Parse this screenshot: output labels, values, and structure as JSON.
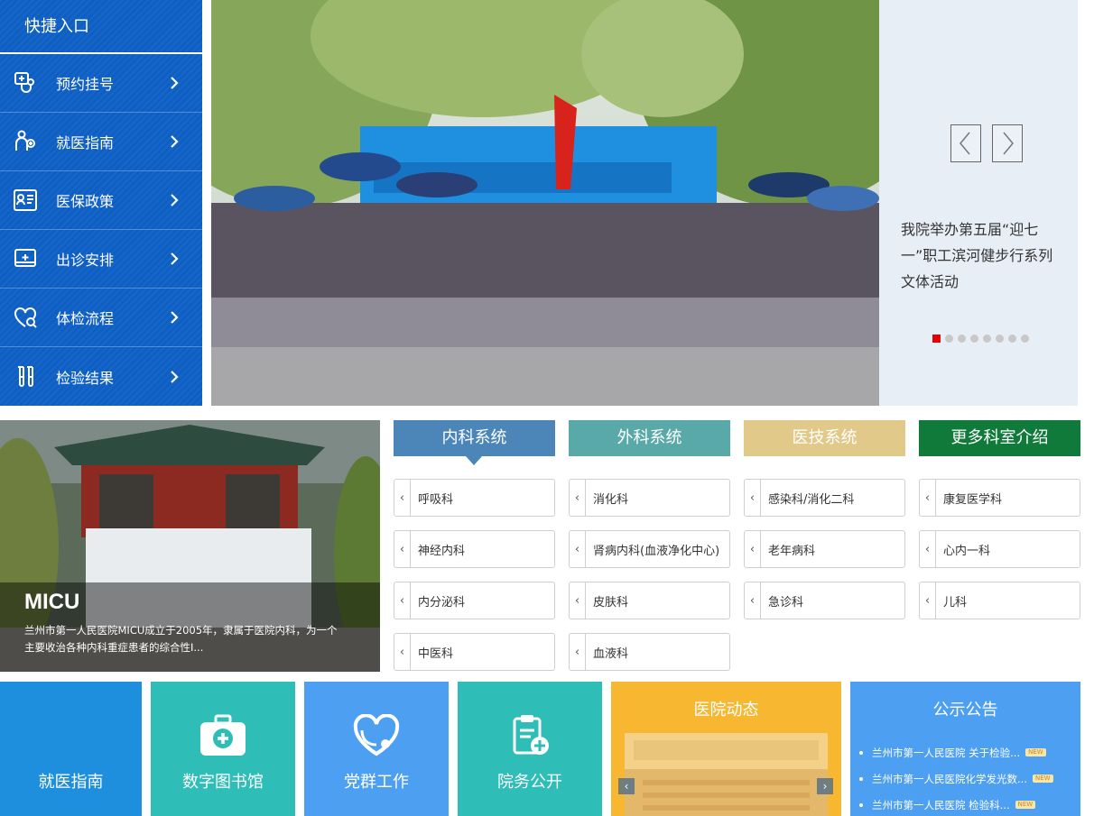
{
  "quick_entry": {
    "title": "快捷入口",
    "items": [
      {
        "label": "预约挂号",
        "icon": "stethoscope-icon"
      },
      {
        "label": "就医指南",
        "icon": "doctor-guide-icon"
      },
      {
        "label": "医保政策",
        "icon": "insurance-card-icon"
      },
      {
        "label": "出诊安排",
        "icon": "schedule-icon"
      },
      {
        "label": "体检流程",
        "icon": "heart-check-icon"
      },
      {
        "label": "检验结果",
        "icon": "test-tubes-icon"
      }
    ]
  },
  "banner": {
    "caption": "我院举办第五届“迎七一”职工滨河健步行系列文体活动",
    "slide_count": 8,
    "active_slide": 1
  },
  "dept_feature": {
    "title": "MICU",
    "description": "兰州市第一人民医院MICU成立于2005年，隶属于医院内科，为一个主要收治各种内科重症患者的综合性I..."
  },
  "dept_tabs": [
    {
      "label": "内科系统"
    },
    {
      "label": "外科系统"
    },
    {
      "label": "医技系统"
    },
    {
      "label": "更多科室介绍"
    }
  ],
  "departments": [
    [
      "呼吸科",
      "神经内科",
      "内分泌科",
      "中医科"
    ],
    [
      "消化科",
      "肾病内科(血液净化中心)",
      "皮肤科",
      "血液科"
    ],
    [
      "感染科/消化二科",
      "老年病科",
      "急诊科"
    ],
    [
      "康复医学科",
      "心内一科",
      "儿科"
    ]
  ],
  "tiles": [
    {
      "label": "就医指南",
      "color": "#1d8fdc"
    },
    {
      "label": "数字图书馆",
      "color": "#2fbdb7",
      "icon": "medical-kit-icon"
    },
    {
      "label": "党群工作",
      "color": "#4d9ff1",
      "icon": "heart-stethoscope-icon"
    },
    {
      "label": "院务公开",
      "color": "#2fbdb7",
      "icon": "clipboard-plus-icon"
    }
  ],
  "news": {
    "title": "医院动态"
  },
  "notices": {
    "title": "公示公告",
    "badge": "NEW",
    "items": [
      "兰州市第一人民医院 关于检验...",
      "兰州市第一人民医院化学发光数...",
      "兰州市第一人民医院 检验科..."
    ]
  },
  "colors": {
    "primary_blue": "#0e5fc4",
    "active_dot": "#e60000"
  }
}
